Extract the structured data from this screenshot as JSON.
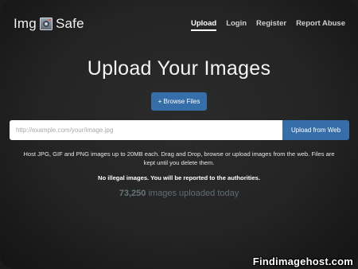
{
  "brand": {
    "name_left": "Img",
    "name_right": "Safe",
    "logo_icon": "camera-icon"
  },
  "nav": {
    "items": [
      {
        "label": "Upload",
        "active": true
      },
      {
        "label": "Login",
        "active": false
      },
      {
        "label": "Register",
        "active": false
      },
      {
        "label": "Report Abuse",
        "active": false
      }
    ]
  },
  "hero": {
    "title": "Upload Your Images",
    "browse_label": "+ Browse Files"
  },
  "url_upload": {
    "placeholder": "http://example.com/your/image.jpg",
    "value": "",
    "button_label": "Upload from Web"
  },
  "info": {
    "text": "Host JPG, GIF and PNG images up to 20MB each. Drag and Drop, browse or upload images from the web. Files are kept until you delete them.",
    "warning": "No illegal images. You will be reported to the authorities."
  },
  "stats": {
    "count": "73,250",
    "suffix": "images uploaded today"
  },
  "watermark": {
    "text": "Findimagehost.com"
  },
  "colors": {
    "accent": "#356ea8",
    "background": "#242424",
    "counter": "#5f6e72"
  }
}
